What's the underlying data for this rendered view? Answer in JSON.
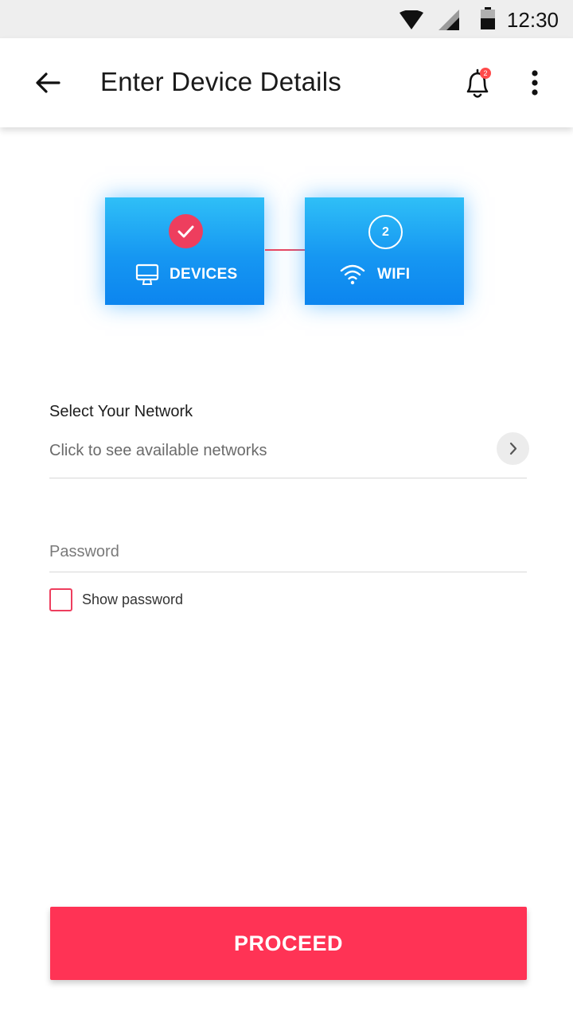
{
  "status_bar": {
    "time": "12:30"
  },
  "app_bar": {
    "title": "Enter Device Details",
    "notification_count": "2"
  },
  "steps": [
    {
      "label": "DEVICES",
      "state": "complete",
      "icon": "monitor-icon"
    },
    {
      "number": "2",
      "label": "WIFI",
      "state": "current",
      "icon": "wifi-icon"
    }
  ],
  "network": {
    "label": "Select Your Network",
    "prompt": "Click to see available networks"
  },
  "password": {
    "placeholder": "Password",
    "value": ""
  },
  "show_password": {
    "label": "Show password",
    "checked": false
  },
  "proceed": {
    "label": "PROCEED"
  },
  "colors": {
    "accent": "#ff3355",
    "step_blue": "#1697f2",
    "check_red": "#ee3e5e"
  }
}
